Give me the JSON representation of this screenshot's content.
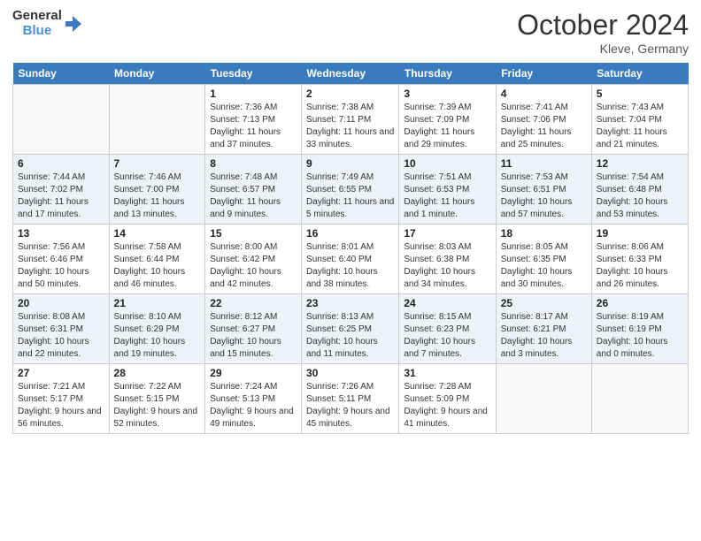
{
  "header": {
    "logo_line1": "General",
    "logo_line2": "Blue",
    "month": "October 2024",
    "location": "Kleve, Germany"
  },
  "days_of_week": [
    "Sunday",
    "Monday",
    "Tuesday",
    "Wednesday",
    "Thursday",
    "Friday",
    "Saturday"
  ],
  "weeks": [
    [
      {
        "day": "",
        "sunrise": "",
        "sunset": "",
        "daylight": ""
      },
      {
        "day": "",
        "sunrise": "",
        "sunset": "",
        "daylight": ""
      },
      {
        "day": "1",
        "sunrise": "Sunrise: 7:36 AM",
        "sunset": "Sunset: 7:13 PM",
        "daylight": "Daylight: 11 hours and 37 minutes."
      },
      {
        "day": "2",
        "sunrise": "Sunrise: 7:38 AM",
        "sunset": "Sunset: 7:11 PM",
        "daylight": "Daylight: 11 hours and 33 minutes."
      },
      {
        "day": "3",
        "sunrise": "Sunrise: 7:39 AM",
        "sunset": "Sunset: 7:09 PM",
        "daylight": "Daylight: 11 hours and 29 minutes."
      },
      {
        "day": "4",
        "sunrise": "Sunrise: 7:41 AM",
        "sunset": "Sunset: 7:06 PM",
        "daylight": "Daylight: 11 hours and 25 minutes."
      },
      {
        "day": "5",
        "sunrise": "Sunrise: 7:43 AM",
        "sunset": "Sunset: 7:04 PM",
        "daylight": "Daylight: 11 hours and 21 minutes."
      }
    ],
    [
      {
        "day": "6",
        "sunrise": "Sunrise: 7:44 AM",
        "sunset": "Sunset: 7:02 PM",
        "daylight": "Daylight: 11 hours and 17 minutes."
      },
      {
        "day": "7",
        "sunrise": "Sunrise: 7:46 AM",
        "sunset": "Sunset: 7:00 PM",
        "daylight": "Daylight: 11 hours and 13 minutes."
      },
      {
        "day": "8",
        "sunrise": "Sunrise: 7:48 AM",
        "sunset": "Sunset: 6:57 PM",
        "daylight": "Daylight: 11 hours and 9 minutes."
      },
      {
        "day": "9",
        "sunrise": "Sunrise: 7:49 AM",
        "sunset": "Sunset: 6:55 PM",
        "daylight": "Daylight: 11 hours and 5 minutes."
      },
      {
        "day": "10",
        "sunrise": "Sunrise: 7:51 AM",
        "sunset": "Sunset: 6:53 PM",
        "daylight": "Daylight: 11 hours and 1 minute."
      },
      {
        "day": "11",
        "sunrise": "Sunrise: 7:53 AM",
        "sunset": "Sunset: 6:51 PM",
        "daylight": "Daylight: 10 hours and 57 minutes."
      },
      {
        "day": "12",
        "sunrise": "Sunrise: 7:54 AM",
        "sunset": "Sunset: 6:48 PM",
        "daylight": "Daylight: 10 hours and 53 minutes."
      }
    ],
    [
      {
        "day": "13",
        "sunrise": "Sunrise: 7:56 AM",
        "sunset": "Sunset: 6:46 PM",
        "daylight": "Daylight: 10 hours and 50 minutes."
      },
      {
        "day": "14",
        "sunrise": "Sunrise: 7:58 AM",
        "sunset": "Sunset: 6:44 PM",
        "daylight": "Daylight: 10 hours and 46 minutes."
      },
      {
        "day": "15",
        "sunrise": "Sunrise: 8:00 AM",
        "sunset": "Sunset: 6:42 PM",
        "daylight": "Daylight: 10 hours and 42 minutes."
      },
      {
        "day": "16",
        "sunrise": "Sunrise: 8:01 AM",
        "sunset": "Sunset: 6:40 PM",
        "daylight": "Daylight: 10 hours and 38 minutes."
      },
      {
        "day": "17",
        "sunrise": "Sunrise: 8:03 AM",
        "sunset": "Sunset: 6:38 PM",
        "daylight": "Daylight: 10 hours and 34 minutes."
      },
      {
        "day": "18",
        "sunrise": "Sunrise: 8:05 AM",
        "sunset": "Sunset: 6:35 PM",
        "daylight": "Daylight: 10 hours and 30 minutes."
      },
      {
        "day": "19",
        "sunrise": "Sunrise: 8:06 AM",
        "sunset": "Sunset: 6:33 PM",
        "daylight": "Daylight: 10 hours and 26 minutes."
      }
    ],
    [
      {
        "day": "20",
        "sunrise": "Sunrise: 8:08 AM",
        "sunset": "Sunset: 6:31 PM",
        "daylight": "Daylight: 10 hours and 22 minutes."
      },
      {
        "day": "21",
        "sunrise": "Sunrise: 8:10 AM",
        "sunset": "Sunset: 6:29 PM",
        "daylight": "Daylight: 10 hours and 19 minutes."
      },
      {
        "day": "22",
        "sunrise": "Sunrise: 8:12 AM",
        "sunset": "Sunset: 6:27 PM",
        "daylight": "Daylight: 10 hours and 15 minutes."
      },
      {
        "day": "23",
        "sunrise": "Sunrise: 8:13 AM",
        "sunset": "Sunset: 6:25 PM",
        "daylight": "Daylight: 10 hours and 11 minutes."
      },
      {
        "day": "24",
        "sunrise": "Sunrise: 8:15 AM",
        "sunset": "Sunset: 6:23 PM",
        "daylight": "Daylight: 10 hours and 7 minutes."
      },
      {
        "day": "25",
        "sunrise": "Sunrise: 8:17 AM",
        "sunset": "Sunset: 6:21 PM",
        "daylight": "Daylight: 10 hours and 3 minutes."
      },
      {
        "day": "26",
        "sunrise": "Sunrise: 8:19 AM",
        "sunset": "Sunset: 6:19 PM",
        "daylight": "Daylight: 10 hours and 0 minutes."
      }
    ],
    [
      {
        "day": "27",
        "sunrise": "Sunrise: 7:21 AM",
        "sunset": "Sunset: 5:17 PM",
        "daylight": "Daylight: 9 hours and 56 minutes."
      },
      {
        "day": "28",
        "sunrise": "Sunrise: 7:22 AM",
        "sunset": "Sunset: 5:15 PM",
        "daylight": "Daylight: 9 hours and 52 minutes."
      },
      {
        "day": "29",
        "sunrise": "Sunrise: 7:24 AM",
        "sunset": "Sunset: 5:13 PM",
        "daylight": "Daylight: 9 hours and 49 minutes."
      },
      {
        "day": "30",
        "sunrise": "Sunrise: 7:26 AM",
        "sunset": "Sunset: 5:11 PM",
        "daylight": "Daylight: 9 hours and 45 minutes."
      },
      {
        "day": "31",
        "sunrise": "Sunrise: 7:28 AM",
        "sunset": "Sunset: 5:09 PM",
        "daylight": "Daylight: 9 hours and 41 minutes."
      },
      {
        "day": "",
        "sunrise": "",
        "sunset": "",
        "daylight": ""
      },
      {
        "day": "",
        "sunrise": "",
        "sunset": "",
        "daylight": ""
      }
    ]
  ]
}
